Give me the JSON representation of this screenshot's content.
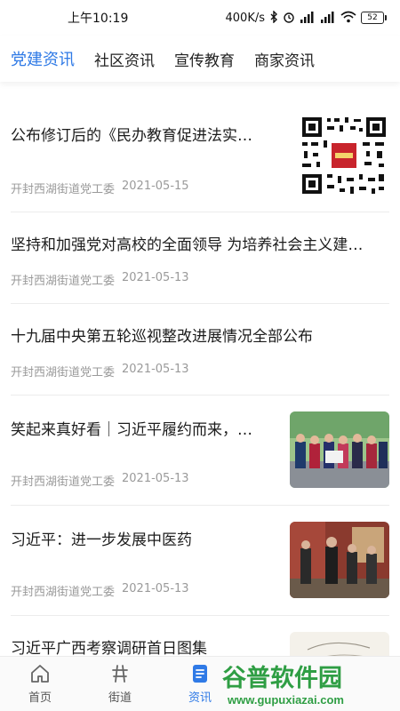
{
  "status_bar": {
    "time": "上午10:19",
    "speed": "400K/s",
    "battery": "52",
    "icons": [
      "bluetooth-icon",
      "alarm-icon",
      "signal-hd-icon",
      "signal-icon",
      "wifi-icon",
      "battery-icon"
    ]
  },
  "tabs": [
    {
      "label": "党建资讯",
      "active": true
    },
    {
      "label": "社区资讯",
      "active": false
    },
    {
      "label": "宣传教育",
      "active": false
    },
    {
      "label": "商家资讯",
      "active": false
    }
  ],
  "articles": [
    {
      "title": "公布修订后的《民办教育促进法实…",
      "source": "开封西湖街道党工委",
      "date": "2021-05-15",
      "thumb": "qr-code"
    },
    {
      "title": "坚持和加强党对高校的全面领导 为培养社会主义建…",
      "source": "开封西湖街道党工委",
      "date": "2021-05-13",
      "thumb": null
    },
    {
      "title": "十九届中央第五轮巡视整改进展情况全部公布",
      "source": "开封西湖街道党工委",
      "date": "2021-05-13",
      "thumb": null
    },
    {
      "title": "笑起来真好看｜习近平履约而来，…",
      "source": "开封西湖街道党工委",
      "date": "2021-05-13",
      "thumb": "group-photo"
    },
    {
      "title": "习近平：进一步发展中医药",
      "source": "开封西湖街道党工委",
      "date": "2021-05-13",
      "thumb": "visit-photo"
    },
    {
      "title": "习近平广西考察调研首日图集",
      "source": "",
      "date": "",
      "thumb": "sketch-photo"
    }
  ],
  "bottom_nav": [
    {
      "label": "首页",
      "icon": "home-icon",
      "active": false
    },
    {
      "label": "街道",
      "icon": "street-icon",
      "active": false
    },
    {
      "label": "资讯",
      "icon": "news-icon",
      "active": true
    }
  ],
  "watermark": {
    "text": "谷普软件园",
    "url": "www.gupuxiazai.com"
  },
  "colors": {
    "accent": "#2f7ae6",
    "meta": "#9a9a9a",
    "watermark": "#2f9e44"
  }
}
